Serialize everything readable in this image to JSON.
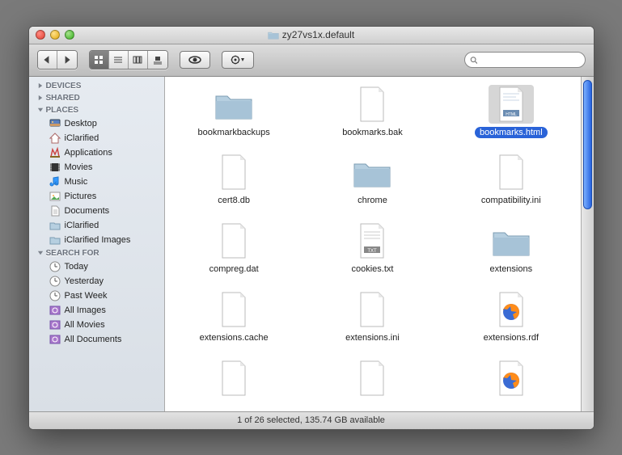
{
  "window": {
    "title": "zy27vs1x.default"
  },
  "sidebar": {
    "sections": [
      {
        "label": "DEVICES",
        "expanded": false,
        "items": []
      },
      {
        "label": "SHARED",
        "expanded": false,
        "items": []
      },
      {
        "label": "PLACES",
        "expanded": true,
        "items": [
          {
            "label": "Desktop",
            "icon": "desktop"
          },
          {
            "label": "iClarified",
            "icon": "home"
          },
          {
            "label": "Applications",
            "icon": "apps"
          },
          {
            "label": "Movies",
            "icon": "movies"
          },
          {
            "label": "Music",
            "icon": "music"
          },
          {
            "label": "Pictures",
            "icon": "pictures"
          },
          {
            "label": "Documents",
            "icon": "documents"
          },
          {
            "label": "iClarified",
            "icon": "folder"
          },
          {
            "label": "iClarified Images",
            "icon": "folder"
          }
        ]
      },
      {
        "label": "SEARCH FOR",
        "expanded": true,
        "items": [
          {
            "label": "Today",
            "icon": "clock"
          },
          {
            "label": "Yesterday",
            "icon": "clock"
          },
          {
            "label": "Past Week",
            "icon": "clock"
          },
          {
            "label": "All Images",
            "icon": "smartimg"
          },
          {
            "label": "All Movies",
            "icon": "smartimg"
          },
          {
            "label": "All Documents",
            "icon": "smartimg"
          }
        ]
      }
    ]
  },
  "files": [
    {
      "name": "bookmarkbackups",
      "type": "folder",
      "selected": false
    },
    {
      "name": "bookmarks.bak",
      "type": "doc",
      "selected": false
    },
    {
      "name": "bookmarks.html",
      "type": "html",
      "selected": true
    },
    {
      "name": "cert8.db",
      "type": "doc",
      "selected": false
    },
    {
      "name": "chrome",
      "type": "folder",
      "selected": false
    },
    {
      "name": "compatibility.ini",
      "type": "doc",
      "selected": false
    },
    {
      "name": "compreg.dat",
      "type": "doc",
      "selected": false
    },
    {
      "name": "cookies.txt",
      "type": "txt",
      "selected": false
    },
    {
      "name": "extensions",
      "type": "folder",
      "selected": false
    },
    {
      "name": "extensions.cache",
      "type": "doc",
      "selected": false
    },
    {
      "name": "extensions.ini",
      "type": "doc",
      "selected": false
    },
    {
      "name": "extensions.rdf",
      "type": "firefox",
      "selected": false
    },
    {
      "name": "",
      "type": "doc",
      "selected": false
    },
    {
      "name": "",
      "type": "doc",
      "selected": false
    },
    {
      "name": "",
      "type": "firefox",
      "selected": false
    }
  ],
  "status": "1 of 26 selected, 135.74 GB available",
  "search": {
    "placeholder": ""
  }
}
